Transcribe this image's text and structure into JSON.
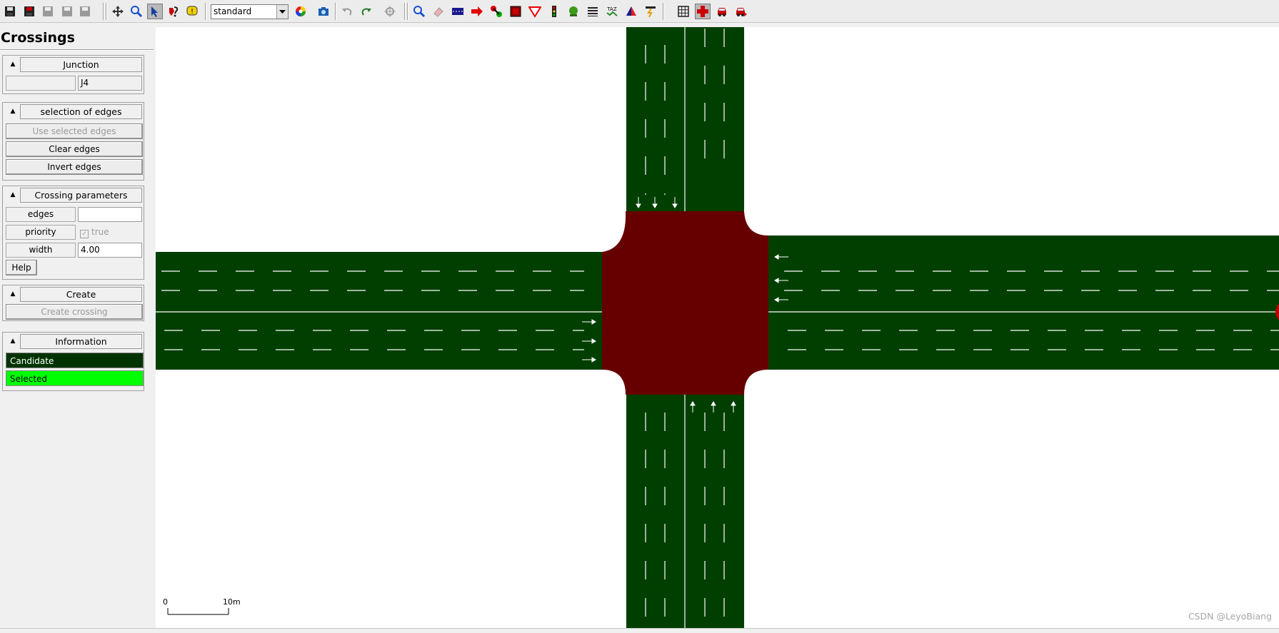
{
  "toolbar": {
    "scheme_value": "standard"
  },
  "frame": {
    "title": "Crossings",
    "junction": {
      "header": "Junction",
      "id_value": "J4"
    },
    "selection": {
      "header": "selection of edges",
      "use_selected": "Use selected edges",
      "clear": "Clear edges",
      "invert": "Invert edges"
    },
    "params": {
      "header": "Crossing parameters",
      "edges_label": "edges",
      "edges_value": "",
      "priority_label": "priority",
      "priority_value": "true",
      "priority_checked": true,
      "width_label": "width",
      "width_value": "4.00",
      "help": "Help"
    },
    "create": {
      "header": "Create",
      "button": "Create crossing"
    },
    "information": {
      "header": "Information",
      "candidate": "Candidate",
      "selected": "Selected",
      "candidate_color": "#003300",
      "selected_color": "#00ff00"
    }
  },
  "view": {
    "scale_start": "0",
    "scale_end": "10m",
    "watermark": "CSDN @LeyoBiang",
    "road_color": "#003f00",
    "junction_color": "#660000"
  }
}
